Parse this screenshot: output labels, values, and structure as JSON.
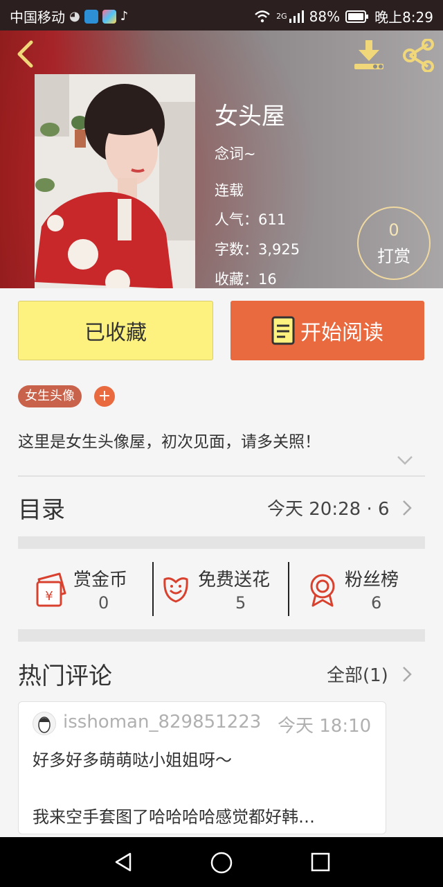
{
  "status_bar": {
    "carrier": "中国移动",
    "network": "2G",
    "battery": "88%",
    "time": "晚上8:29"
  },
  "book": {
    "title": "女头屋",
    "author": "念词~",
    "status": "连载",
    "popularity_label": "人气：611",
    "words_label": "字数：3,925",
    "favorites_label": "收藏：16",
    "tip_count": "0",
    "tip_label": "打赏"
  },
  "actions": {
    "collected_label": "已收藏",
    "read_label": "开始阅读"
  },
  "tags": {
    "items": [
      "女生头像"
    ],
    "add": "+"
  },
  "intro": "这里是女生头像屋，初次见面，请多关照！",
  "toc": {
    "label": "目录",
    "meta": "今天 20:28 · 6"
  },
  "stats": [
    {
      "label": "赏金币",
      "value": "0"
    },
    {
      "label": "免费送花",
      "value": "5"
    },
    {
      "label": "粉丝榜",
      "value": "6"
    }
  ],
  "comments": {
    "header": "热门评论",
    "all_label": "全部(1)",
    "items": [
      {
        "user": "isshoman_829851223",
        "time": "今天 18:10",
        "line1": "好多好多萌萌哒小姐姐呀～",
        "line2": "我来空手套图了哈哈哈哈感觉都好韩…"
      }
    ]
  },
  "colors": {
    "accent": "#e96a3f",
    "collected_bg": "#fdf17f",
    "tag": "#c9624a",
    "icon_yellow": "#f0d77a",
    "icon_red": "#d9412f"
  }
}
